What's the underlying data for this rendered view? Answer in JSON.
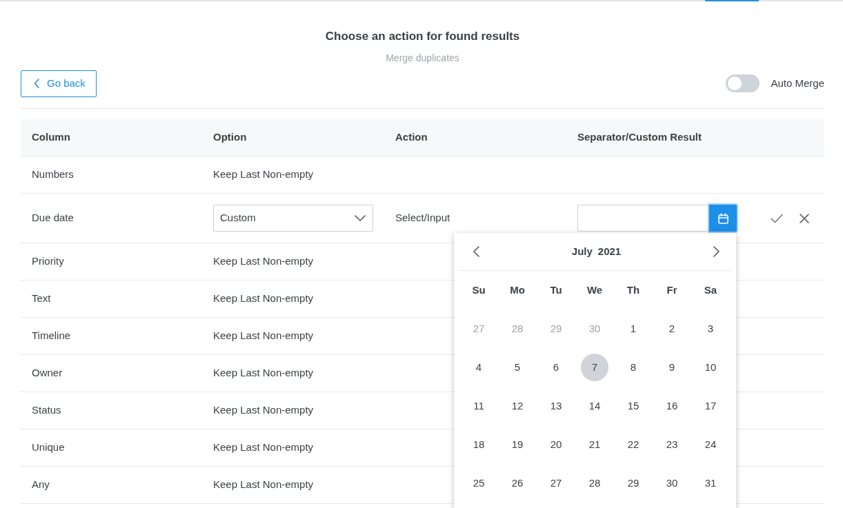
{
  "header": {
    "title": "Choose an action for found results",
    "subtitle": "Merge duplicates"
  },
  "back_button": {
    "label": "Go back"
  },
  "auto_merge": {
    "label": "Auto Merge",
    "on": false
  },
  "table": {
    "columns": [
      "Column",
      "Option",
      "Action",
      "Separator/Custom Result"
    ],
    "rows": [
      {
        "kind": "plain",
        "column": "Numbers",
        "option": "Keep Last Non-empty"
      },
      {
        "kind": "edit",
        "column": "Due date",
        "option": "Custom",
        "action": "Select/Input"
      },
      {
        "kind": "plain",
        "column": "Priority",
        "option": "Keep Last Non-empty"
      },
      {
        "kind": "plain",
        "column": "Text",
        "option": "Keep Last Non-empty"
      },
      {
        "kind": "plain",
        "column": "Timeline",
        "option": "Keep Last Non-empty"
      },
      {
        "kind": "plain",
        "column": "Owner",
        "option": "Keep Last Non-empty"
      },
      {
        "kind": "plain",
        "column": "Status",
        "option": "Keep Last Non-empty"
      },
      {
        "kind": "plain",
        "column": "Unique",
        "option": "Keep Last Non-empty"
      },
      {
        "kind": "plain",
        "column": "Any",
        "option": "Keep Last Non-empty"
      }
    ]
  },
  "date_picker": {
    "open": true,
    "month": "July",
    "year": "2021",
    "weekdays": [
      "Su",
      "Mo",
      "Tu",
      "We",
      "Th",
      "Fr",
      "Sa"
    ],
    "weeks": [
      [
        {
          "day": "27",
          "muted": true,
          "today": false
        },
        {
          "day": "28",
          "muted": true,
          "today": false
        },
        {
          "day": "29",
          "muted": true,
          "today": false
        },
        {
          "day": "30",
          "muted": true,
          "today": false
        },
        {
          "day": "1",
          "muted": false,
          "today": false
        },
        {
          "day": "2",
          "muted": false,
          "today": false
        },
        {
          "day": "3",
          "muted": false,
          "today": false
        }
      ],
      [
        {
          "day": "4",
          "muted": false,
          "today": false
        },
        {
          "day": "5",
          "muted": false,
          "today": false
        },
        {
          "day": "6",
          "muted": false,
          "today": false
        },
        {
          "day": "7",
          "muted": false,
          "today": true
        },
        {
          "day": "8",
          "muted": false,
          "today": false
        },
        {
          "day": "9",
          "muted": false,
          "today": false
        },
        {
          "day": "10",
          "muted": false,
          "today": false
        }
      ],
      [
        {
          "day": "11",
          "muted": false,
          "today": false
        },
        {
          "day": "12",
          "muted": false,
          "today": false
        },
        {
          "day": "13",
          "muted": false,
          "today": false
        },
        {
          "day": "14",
          "muted": false,
          "today": false
        },
        {
          "day": "15",
          "muted": false,
          "today": false
        },
        {
          "day": "16",
          "muted": false,
          "today": false
        },
        {
          "day": "17",
          "muted": false,
          "today": false
        }
      ],
      [
        {
          "day": "18",
          "muted": false,
          "today": false
        },
        {
          "day": "19",
          "muted": false,
          "today": false
        },
        {
          "day": "20",
          "muted": false,
          "today": false
        },
        {
          "day": "21",
          "muted": false,
          "today": false
        },
        {
          "day": "22",
          "muted": false,
          "today": false
        },
        {
          "day": "23",
          "muted": false,
          "today": false
        },
        {
          "day": "24",
          "muted": false,
          "today": false
        }
      ],
      [
        {
          "day": "25",
          "muted": false,
          "today": false
        },
        {
          "day": "26",
          "muted": false,
          "today": false
        },
        {
          "day": "27",
          "muted": false,
          "today": false
        },
        {
          "day": "28",
          "muted": false,
          "today": false
        },
        {
          "day": "29",
          "muted": false,
          "today": false
        },
        {
          "day": "30",
          "muted": false,
          "today": false
        },
        {
          "day": "31",
          "muted": false,
          "today": false
        }
      ]
    ]
  }
}
